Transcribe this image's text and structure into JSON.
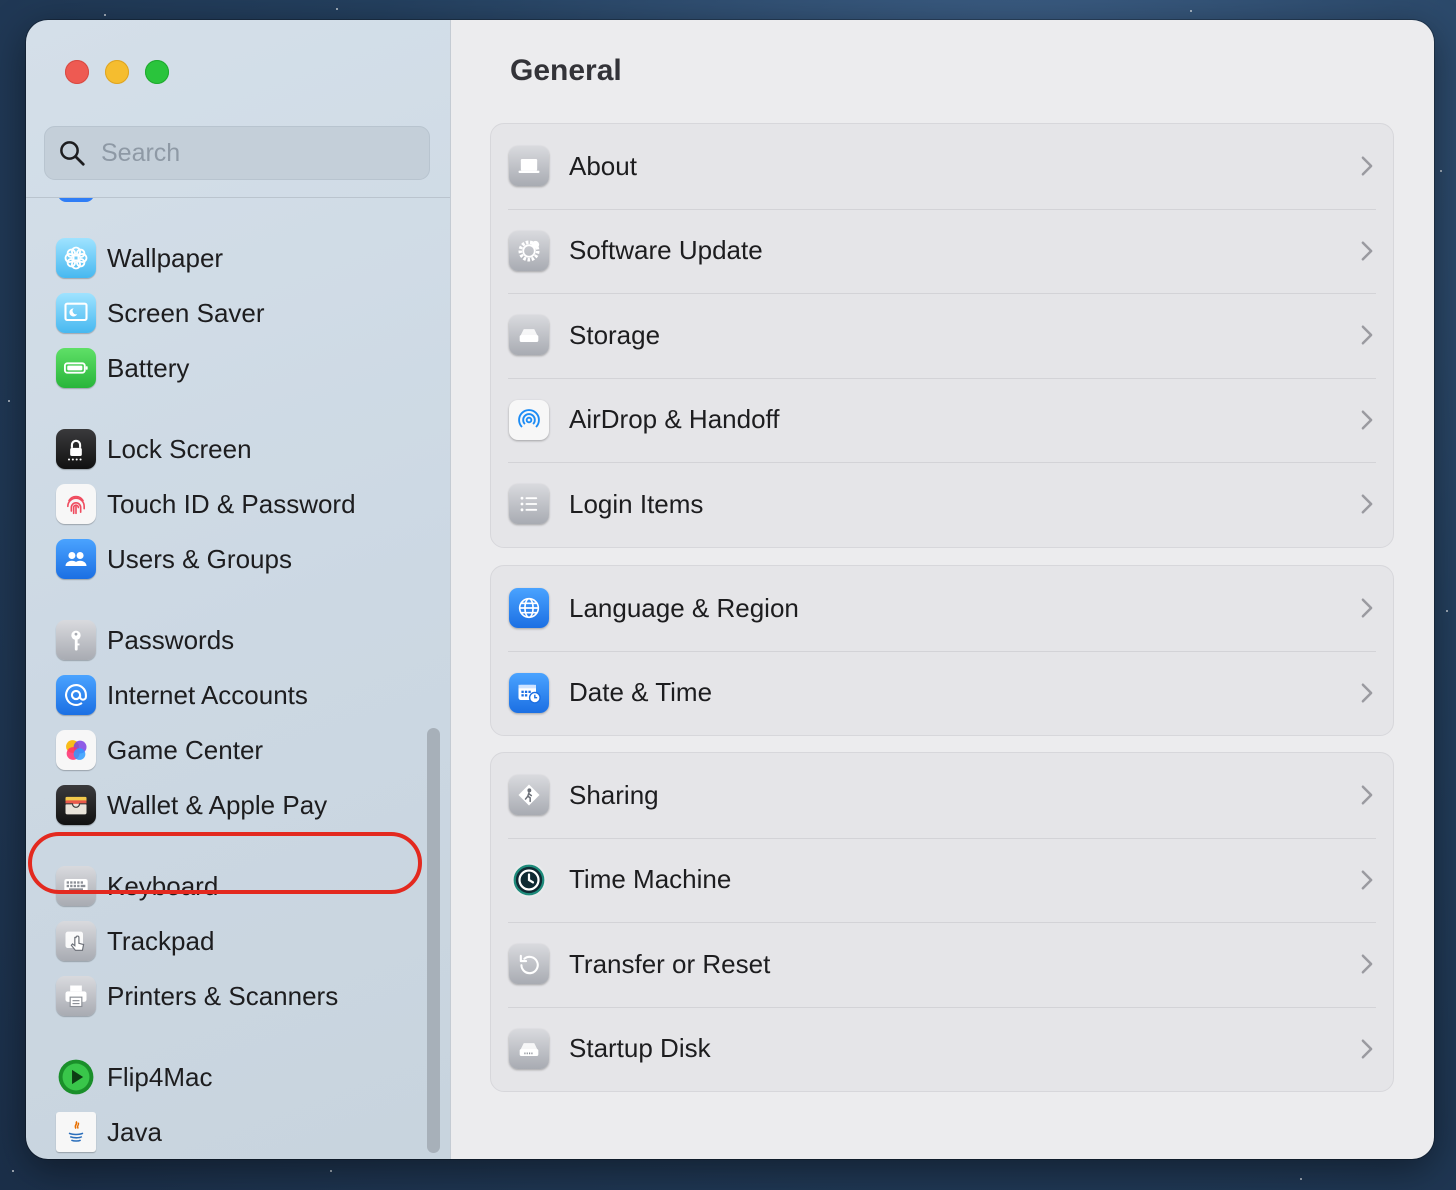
{
  "window": {
    "traffic_lights": [
      "close",
      "minimize",
      "zoom"
    ]
  },
  "sidebar": {
    "search_placeholder": "Search",
    "items": [
      {
        "label": "Wallpaper",
        "icon": "wallpaper-icon"
      },
      {
        "label": "Screen Saver",
        "icon": "screen-saver-icon"
      },
      {
        "label": "Battery",
        "icon": "battery-icon"
      },
      {
        "label": "Lock Screen",
        "icon": "lock-icon"
      },
      {
        "label": "Touch ID & Password",
        "icon": "fingerprint-icon"
      },
      {
        "label": "Users & Groups",
        "icon": "users-icon"
      },
      {
        "label": "Passwords",
        "icon": "key-icon"
      },
      {
        "label": "Internet Accounts",
        "icon": "at-sign-icon"
      },
      {
        "label": "Game Center",
        "icon": "game-center-icon"
      },
      {
        "label": "Wallet & Apple Pay",
        "icon": "wallet-icon"
      },
      {
        "label": "Keyboard",
        "icon": "keyboard-icon",
        "highlighted": true
      },
      {
        "label": "Trackpad",
        "icon": "trackpad-icon"
      },
      {
        "label": "Printers & Scanners",
        "icon": "printer-icon"
      },
      {
        "label": "Flip4Mac",
        "icon": "flip4mac-icon"
      },
      {
        "label": "Java",
        "icon": "java-icon"
      }
    ]
  },
  "main": {
    "title": "General",
    "groups": [
      [
        {
          "label": "About",
          "icon": "laptop-icon"
        },
        {
          "label": "Software Update",
          "icon": "gear-icon"
        },
        {
          "label": "Storage",
          "icon": "disk-icon"
        },
        {
          "label": "AirDrop & Handoff",
          "icon": "airdrop-icon"
        },
        {
          "label": "Login Items",
          "icon": "list-icon"
        }
      ],
      [
        {
          "label": "Language & Region",
          "icon": "globe-icon"
        },
        {
          "label": "Date & Time",
          "icon": "calendar-clock-icon"
        }
      ],
      [
        {
          "label": "Sharing",
          "icon": "sharing-icon"
        },
        {
          "label": "Time Machine",
          "icon": "time-machine-icon"
        },
        {
          "label": "Transfer or Reset",
          "icon": "reset-icon"
        },
        {
          "label": "Startup Disk",
          "icon": "startup-disk-icon"
        }
      ]
    ]
  },
  "colors": {
    "highlight_ring": "#e3291f",
    "accent_blue": "#2f7df6"
  }
}
